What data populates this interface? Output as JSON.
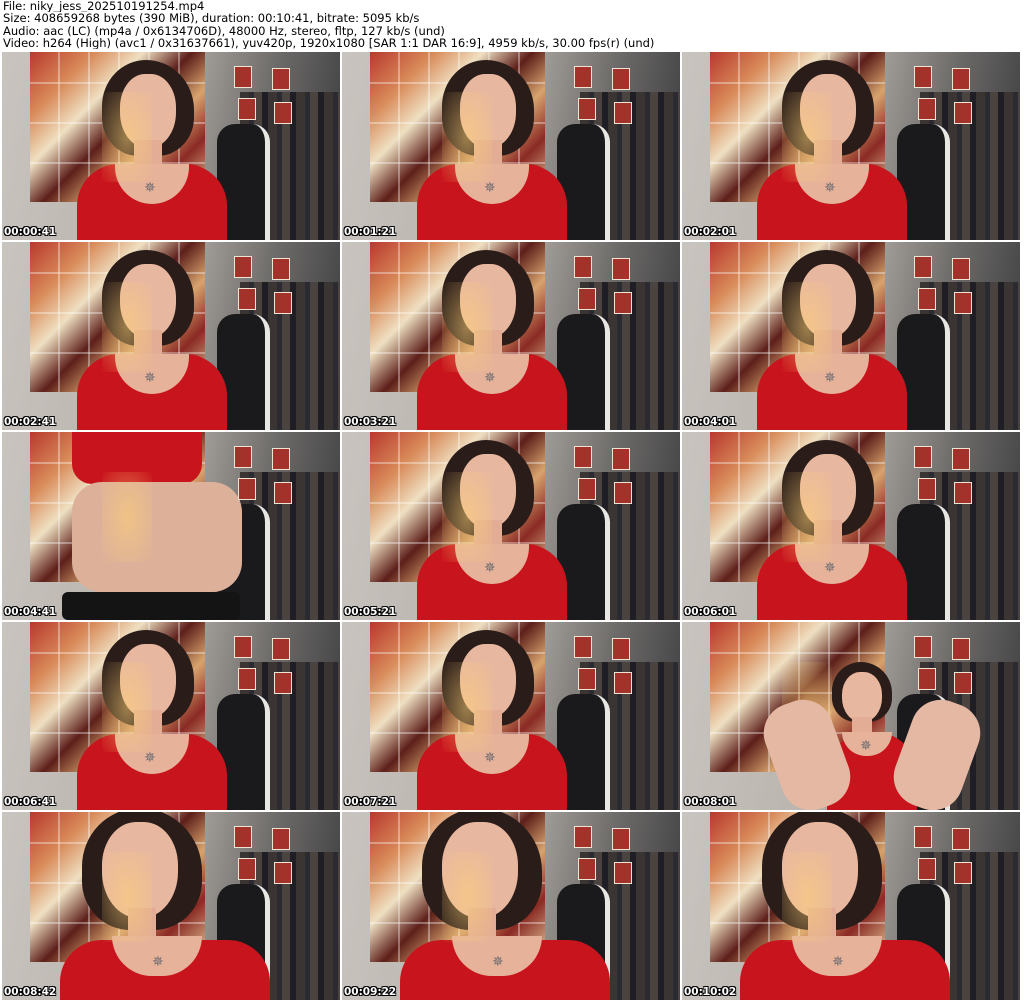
{
  "header": {
    "file": "File: niky_jess_202510191254.mp4",
    "size": "Size: 408659268 bytes (390 MiB), duration: 00:10:41, bitrate: 5095 kb/s",
    "audio": "Audio: aac (LC) (mp4a / 0x6134706D), 48000 Hz, stereo, fltp, 127 kb/s (und)",
    "video": "Video: h264 (High) (avc1 / 0x31637661), yuv420p, 1920x1080 [SAR 1:1 DAR 16:9], 4959 kb/s, 30.00 fps(r) (und)"
  },
  "thumbnails": [
    {
      "time": "00:00:41",
      "variant": "normal"
    },
    {
      "time": "00:01:21",
      "variant": "normal"
    },
    {
      "time": "00:02:01",
      "variant": "normal"
    },
    {
      "time": "00:02:41",
      "variant": "normal"
    },
    {
      "time": "00:03:21",
      "variant": "normal"
    },
    {
      "time": "00:04:01",
      "variant": "normal"
    },
    {
      "time": "00:04:41",
      "variant": "low"
    },
    {
      "time": "00:05:21",
      "variant": "normal"
    },
    {
      "time": "00:06:01",
      "variant": "normal"
    },
    {
      "time": "00:06:41",
      "variant": "normal"
    },
    {
      "time": "00:07:21",
      "variant": "normal"
    },
    {
      "time": "00:08:01",
      "variant": "legs"
    },
    {
      "time": "00:08:42",
      "variant": "close"
    },
    {
      "time": "00:09:22",
      "variant": "close"
    },
    {
      "time": "00:10:02",
      "variant": "close"
    }
  ],
  "colors": {
    "shirt": "#c8141c",
    "timestamp": "#ffffff"
  }
}
